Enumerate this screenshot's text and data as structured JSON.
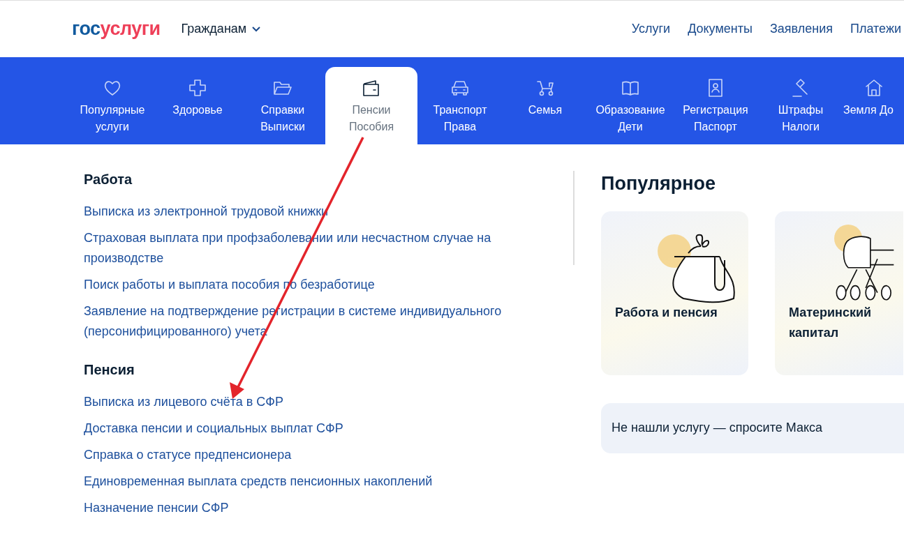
{
  "header": {
    "logo": {
      "part_1": "гос",
      "part_2": "услуги"
    },
    "audience": "Гражданам",
    "links": [
      "Услуги",
      "Документы",
      "Заявления",
      "Платежи"
    ]
  },
  "categories": [
    {
      "lines": [
        "Популярные",
        "услуги"
      ],
      "selected": false
    },
    {
      "lines": [
        "Здоровье"
      ],
      "selected": false
    },
    {
      "lines": [
        "Справки",
        "Выписки"
      ],
      "selected": false
    },
    {
      "lines": [
        "Пенсии",
        "Пособия"
      ],
      "selected": true
    },
    {
      "lines": [
        "Транспорт",
        "Права"
      ],
      "selected": false
    },
    {
      "lines": [
        "Семья"
      ],
      "selected": false
    },
    {
      "lines": [
        "Образование",
        "Дети"
      ],
      "selected": false
    },
    {
      "lines": [
        "Регистрация",
        "Паспорт"
      ],
      "selected": false
    },
    {
      "lines": [
        "Штрафы",
        "Налоги"
      ],
      "selected": false
    },
    {
      "lines": [
        "Земля До"
      ],
      "selected": false
    }
  ],
  "sections": [
    {
      "title": "Работа",
      "links": [
        "Выписка из электронной трудовой книжки",
        "Страховая выплата при профзаболевании или несчастном случае на производстве",
        "Поиск работы и выплата пособия по безработице",
        "Заявление на подтверждение регистрации в системе индивидуального (персонифицированного) учета"
      ]
    },
    {
      "title": "Пенсия",
      "links": [
        "Выписка из лицевого счёта в СФР",
        "Доставка пенсии и социальных выплат СФР",
        "Справка о статусе предпенсионера",
        "Единовременная выплата средств пенсионных накоплений",
        "Назначение пенсии СФР"
      ]
    }
  ],
  "popular": {
    "title": "Популярное",
    "cards": [
      {
        "kind": "purse",
        "label": "Работа и пенсия"
      },
      {
        "kind": "pram",
        "label": "Материнский капитал"
      }
    ],
    "ask": "Не нашли услугу — спросите Макса"
  }
}
